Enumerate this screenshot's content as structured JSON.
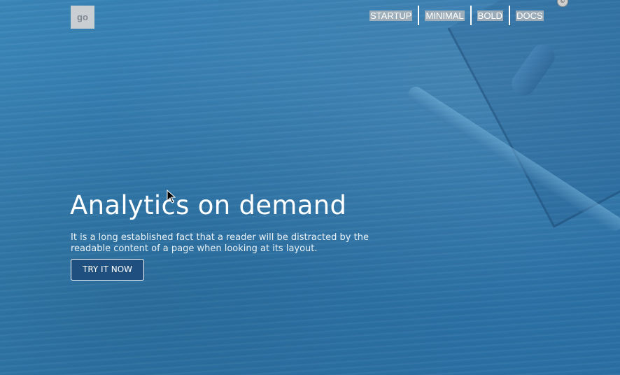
{
  "header": {
    "logo_text": "go",
    "nav": [
      {
        "label": "STARTUP"
      },
      {
        "label": "MINIMAL"
      },
      {
        "label": "BOLD"
      },
      {
        "label": "DOCS"
      }
    ]
  },
  "hero": {
    "title": "Analytics on demand",
    "lead": "It is a long established fact that a reader will be distracted by the readable content of a page when looking at its layout.",
    "cta_label": "TRY IT NOW"
  },
  "icons": {
    "corner_badge": "©",
    "cursor": "mouse-pointer-icon"
  },
  "colors": {
    "background": "#2f78ad",
    "cta_background": "#1f4f7e",
    "text": "#ffffff"
  }
}
